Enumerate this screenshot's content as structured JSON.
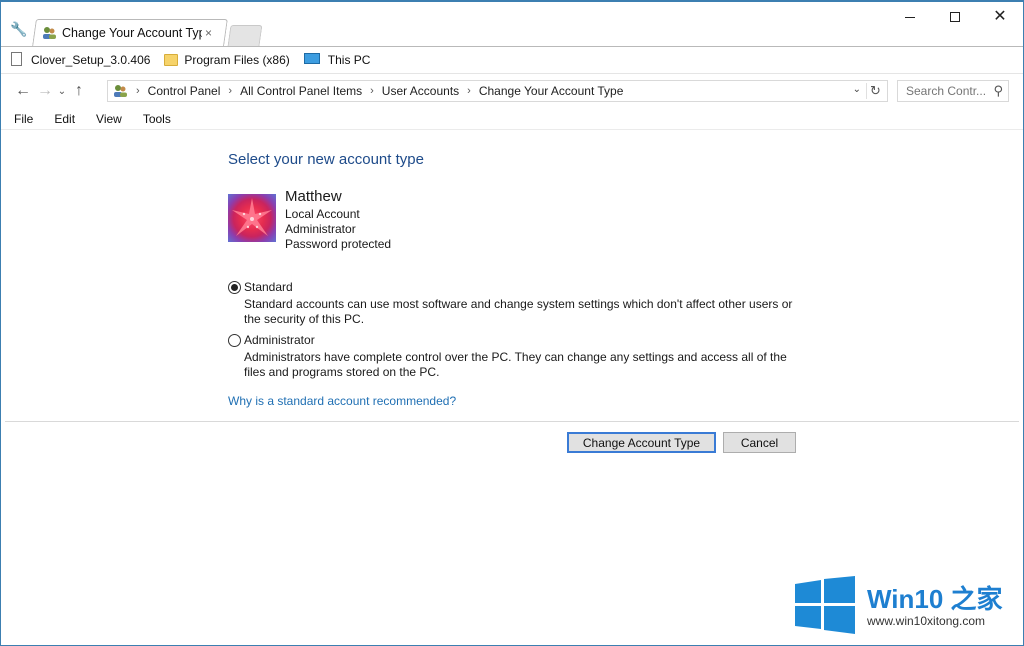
{
  "tab": {
    "title": "Change Your Account Type",
    "close_glyph": "×"
  },
  "bookmarks": [
    {
      "label": "Clover_Setup_3.0.406",
      "icon": "file-icon"
    },
    {
      "label": "Program Files (x86)",
      "icon": "folder-icon"
    },
    {
      "label": "This PC",
      "icon": "computer-icon"
    }
  ],
  "address": {
    "crumbs": [
      "Control Panel",
      "All Control Panel Items",
      "User Accounts",
      "Change Your Account Type"
    ],
    "separator": "›"
  },
  "search": {
    "placeholder": "Search Contr..."
  },
  "menu": [
    "File",
    "Edit",
    "View",
    "Tools"
  ],
  "content": {
    "heading": "Select your new account type",
    "user": {
      "name": "Matthew",
      "lines": [
        "Local Account",
        "Administrator",
        "Password protected"
      ]
    },
    "options": [
      {
        "label": "Standard",
        "checked": true,
        "description": "Standard accounts can use most software and change system settings which don't affect other users or the security of this PC."
      },
      {
        "label": "Administrator",
        "checked": false,
        "description": "Administrators have complete control over the PC. They can change any settings and access all of the files and programs stored on the PC."
      }
    ],
    "help_link": "Why is a standard account recommended?",
    "buttons": {
      "change": "Change Account Type",
      "cancel": "Cancel"
    }
  },
  "watermark": {
    "brand": "Win10 之家",
    "url": "www.win10xitong.com"
  },
  "colors": {
    "heading": "#1e4b8a",
    "link": "#1f6fb3",
    "window_border": "#3c7fb1",
    "brand": "#1e7fd0"
  }
}
